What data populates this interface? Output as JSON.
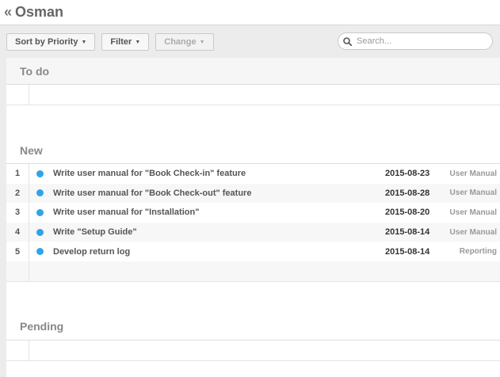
{
  "header": {
    "back_icon": "«",
    "title": "Osman"
  },
  "toolbar": {
    "sort_label": "Sort by Priority",
    "filter_label": "Filter",
    "change_label": "Change",
    "search_placeholder": "Search..."
  },
  "sections": {
    "todo": {
      "title": "To do"
    },
    "new": {
      "title": "New",
      "items": [
        {
          "num": "1",
          "title": "Write user manual for \"Book Check-in\" feature",
          "date": "2015-08-23",
          "category": "User Manual"
        },
        {
          "num": "2",
          "title": "Write user manual for \"Book Check-out\" feature",
          "date": "2015-08-28",
          "category": "User Manual"
        },
        {
          "num": "3",
          "title": "Write user manual for \"Installation\"",
          "date": "2015-08-20",
          "category": "User Manual"
        },
        {
          "num": "4",
          "title": "Write \"Setup Guide\"",
          "date": "2015-08-14",
          "category": "User Manual"
        },
        {
          "num": "5",
          "title": "Develop return log",
          "date": "2015-08-14",
          "category": "Reporting"
        }
      ]
    },
    "pending": {
      "title": "Pending"
    }
  },
  "colors": {
    "status_dot": "#2fa4e7",
    "toolbar_bg": "#ececec"
  }
}
